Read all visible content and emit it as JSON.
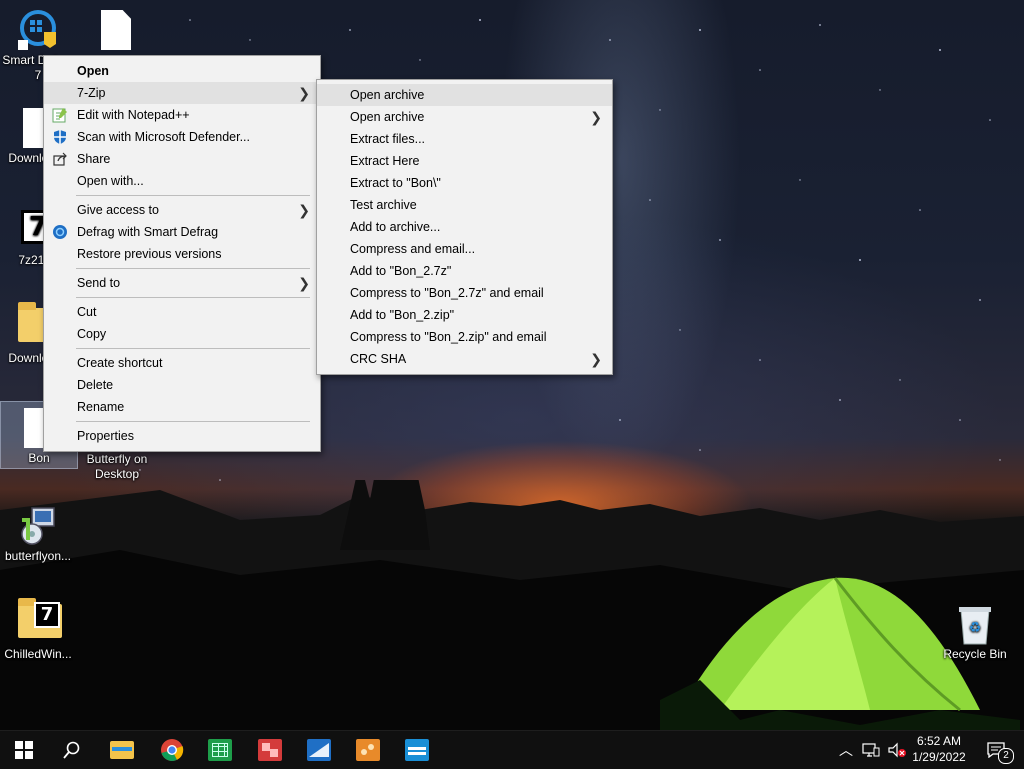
{
  "desktop": {
    "icons": [
      {
        "label": "Smart Defrag 7"
      },
      {
        "label": ""
      },
      {
        "label": "Downloads"
      },
      {
        "label": "7z2106"
      },
      {
        "label": "Downloads"
      },
      {
        "label": "Bon"
      },
      {
        "label": "Butterfly on Desktop"
      },
      {
        "label": "butterflyon..."
      },
      {
        "label": "ChilledWin..."
      },
      {
        "label": "Recycle Bin"
      }
    ]
  },
  "context_menu": {
    "items": [
      {
        "label": "Open"
      },
      {
        "label": "7-Zip"
      },
      {
        "label": "Edit with Notepad++"
      },
      {
        "label": "Scan with Microsoft Defender..."
      },
      {
        "label": "Share"
      },
      {
        "label": "Open with..."
      },
      {
        "label": "Give access to"
      },
      {
        "label": "Defrag with Smart Defrag"
      },
      {
        "label": "Restore previous versions"
      },
      {
        "label": "Send to"
      },
      {
        "label": "Cut"
      },
      {
        "label": "Copy"
      },
      {
        "label": "Create shortcut"
      },
      {
        "label": "Delete"
      },
      {
        "label": "Rename"
      },
      {
        "label": "Properties"
      }
    ]
  },
  "zip_submenu": {
    "items": [
      {
        "label": "Open archive"
      },
      {
        "label": "Open archive"
      },
      {
        "label": "Extract files..."
      },
      {
        "label": "Extract Here"
      },
      {
        "label": "Extract to \"Bon\\\""
      },
      {
        "label": "Test archive"
      },
      {
        "label": "Add to archive..."
      },
      {
        "label": "Compress and email..."
      },
      {
        "label": "Add to \"Bon_2.7z\""
      },
      {
        "label": "Compress to \"Bon_2.7z\" and email"
      },
      {
        "label": "Add to \"Bon_2.zip\""
      },
      {
        "label": "Compress to \"Bon_2.zip\" and email"
      },
      {
        "label": "CRC SHA"
      }
    ]
  },
  "taskbar": {
    "apps": [
      "start-icon",
      "search-icon",
      "file-explorer-icon",
      "chrome-icon",
      "sheets-icon",
      "presentation-icon",
      "mail-icon",
      "photos-icon",
      "app-icon"
    ],
    "clock_time": "6:52 AM",
    "clock_date": "1/29/2022",
    "notification_count": "2"
  },
  "colors": {
    "menu_bg": "#f2f2f2",
    "menu_highlight": "#e1e1e1",
    "taskbar_bg": "#101010"
  }
}
